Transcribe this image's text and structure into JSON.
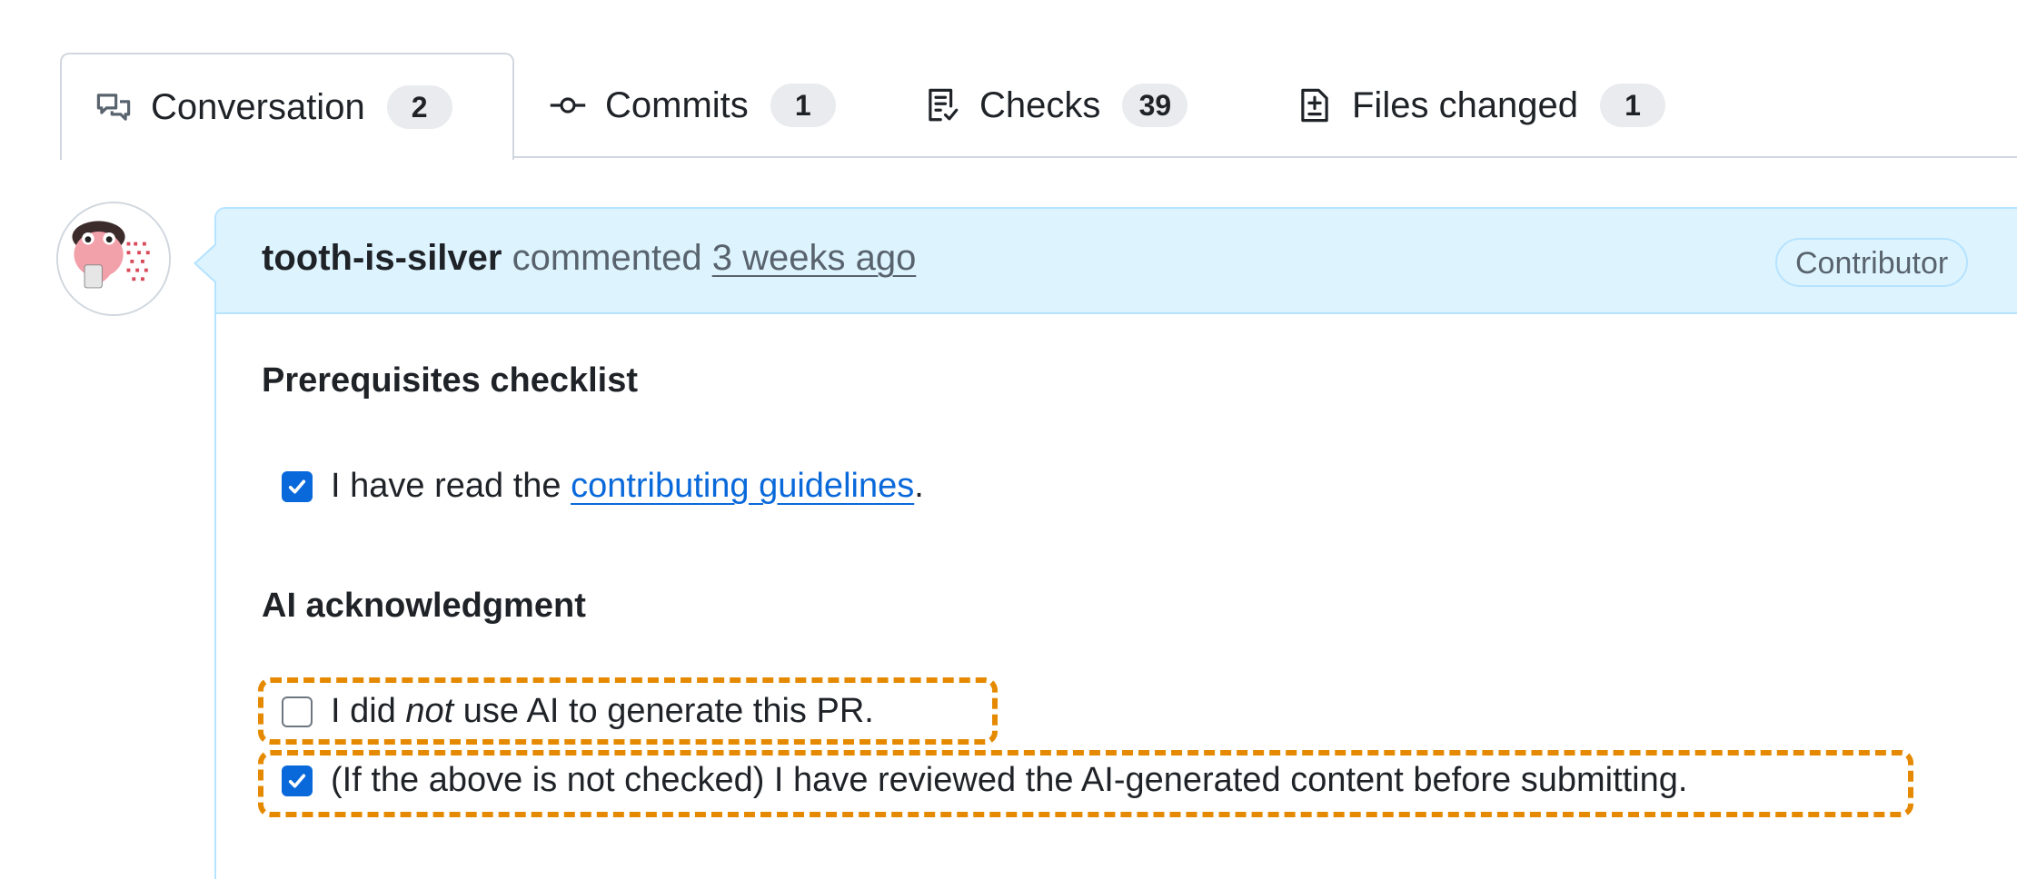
{
  "tabs": [
    {
      "label": "Conversation",
      "count": "2",
      "icon": "comment-discussion-icon",
      "selected": true
    },
    {
      "label": "Commits",
      "count": "1",
      "icon": "git-commit-icon",
      "selected": false
    },
    {
      "label": "Checks",
      "count": "39",
      "icon": "checklist-icon",
      "selected": false
    },
    {
      "label": "Files changed",
      "count": "1",
      "icon": "file-diff-icon",
      "selected": false
    }
  ],
  "comment": {
    "author": "tooth-is-silver",
    "action": "commented",
    "time": "3 weeks ago",
    "role": "Contributor",
    "avatar_icon": "user-avatar-icon"
  },
  "body": {
    "prereq_title": "Prerequisites checklist",
    "prereq_item": {
      "checked": true,
      "prefix": "I have read the ",
      "link": "contributing guidelines",
      "suffix": "."
    },
    "ai_title": "AI acknowledgment",
    "ai_item1": {
      "checked": false,
      "prefix": "I did ",
      "emphasis": "not",
      "suffix": " use AI to generate this PR."
    },
    "ai_item2": {
      "checked": true,
      "text": "(If the above is not checked) I have reviewed the AI-generated content before submitting."
    }
  },
  "colors": {
    "accent": "#0969da",
    "highlight": "#e58a00",
    "header_bg": "#ddf4ff",
    "header_border": "#b6e3ff"
  }
}
